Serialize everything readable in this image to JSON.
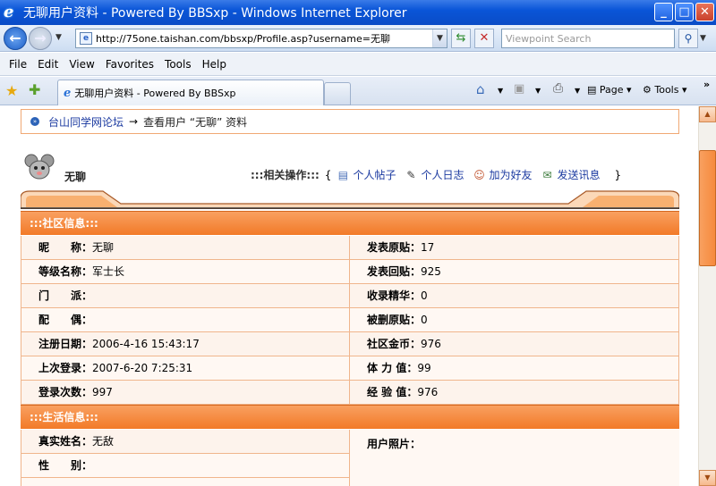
{
  "window": {
    "title": "无聊用户资料 - Powered By BBSxp - Windows Internet Explorer",
    "minimize": "_",
    "maximize": "□",
    "close": "✕"
  },
  "address_bar": {
    "url": "http://75one.taishan.com/bbsxp/Profile.asp?username=无聊",
    "search_placeholder": "Viewpoint Search"
  },
  "menu": [
    "File",
    "Edit",
    "View",
    "Favorites",
    "Tools",
    "Help"
  ],
  "tab": {
    "title": "无聊用户资料 - Powered By BBSxp"
  },
  "commands": {
    "page": "Page",
    "tools": "Tools"
  },
  "breadcrumb": {
    "forum": "台山同学网论坛",
    "arrow": "→",
    "current": "查看用户 “无聊” 资料"
  },
  "profile": {
    "username": "无聊"
  },
  "actions": {
    "label": ":::相关操作:::",
    "open": "{",
    "close": "}",
    "items": [
      "个人帖子",
      "个人日志",
      "加为好友",
      "发送讯息"
    ]
  },
  "community": {
    "title": ":::社区信息:::",
    "rows": [
      {
        "left_label": "昵　　称：",
        "left_value": "无聊",
        "right_label": "发表原贴：",
        "right_value": "17"
      },
      {
        "left_label": "等级名称：",
        "left_value": "军士长",
        "right_label": "发表回贴：",
        "right_value": "925"
      },
      {
        "left_label": "门　　派：",
        "left_value": "",
        "right_label": "收录精华：",
        "right_value": "0"
      },
      {
        "left_label": "配　　偶：",
        "left_value": "",
        "right_label": "被删原贴：",
        "right_value": "0"
      },
      {
        "left_label": "注册日期：",
        "left_value": "2006-4-16 15:43:17",
        "right_label": "社区金币：",
        "right_value": "976"
      },
      {
        "left_label": "上次登录：",
        "left_value": "2007-6-20 7:25:31",
        "right_label": "体 力 值：",
        "right_value": "99"
      },
      {
        "left_label": "登录次数：",
        "left_value": "997",
        "right_label": "经 验 值：",
        "right_value": "976"
      }
    ]
  },
  "life": {
    "title": ":::生活信息:::",
    "real_name_label": "真实姓名：",
    "real_name_value": "无敌",
    "gender_label": "性　　别：",
    "gender_value": "",
    "photo_label": "用户照片："
  },
  "colors": {
    "accent": "#f27a28",
    "row_border": "#f0b58c",
    "link": "#1b3aa0"
  }
}
